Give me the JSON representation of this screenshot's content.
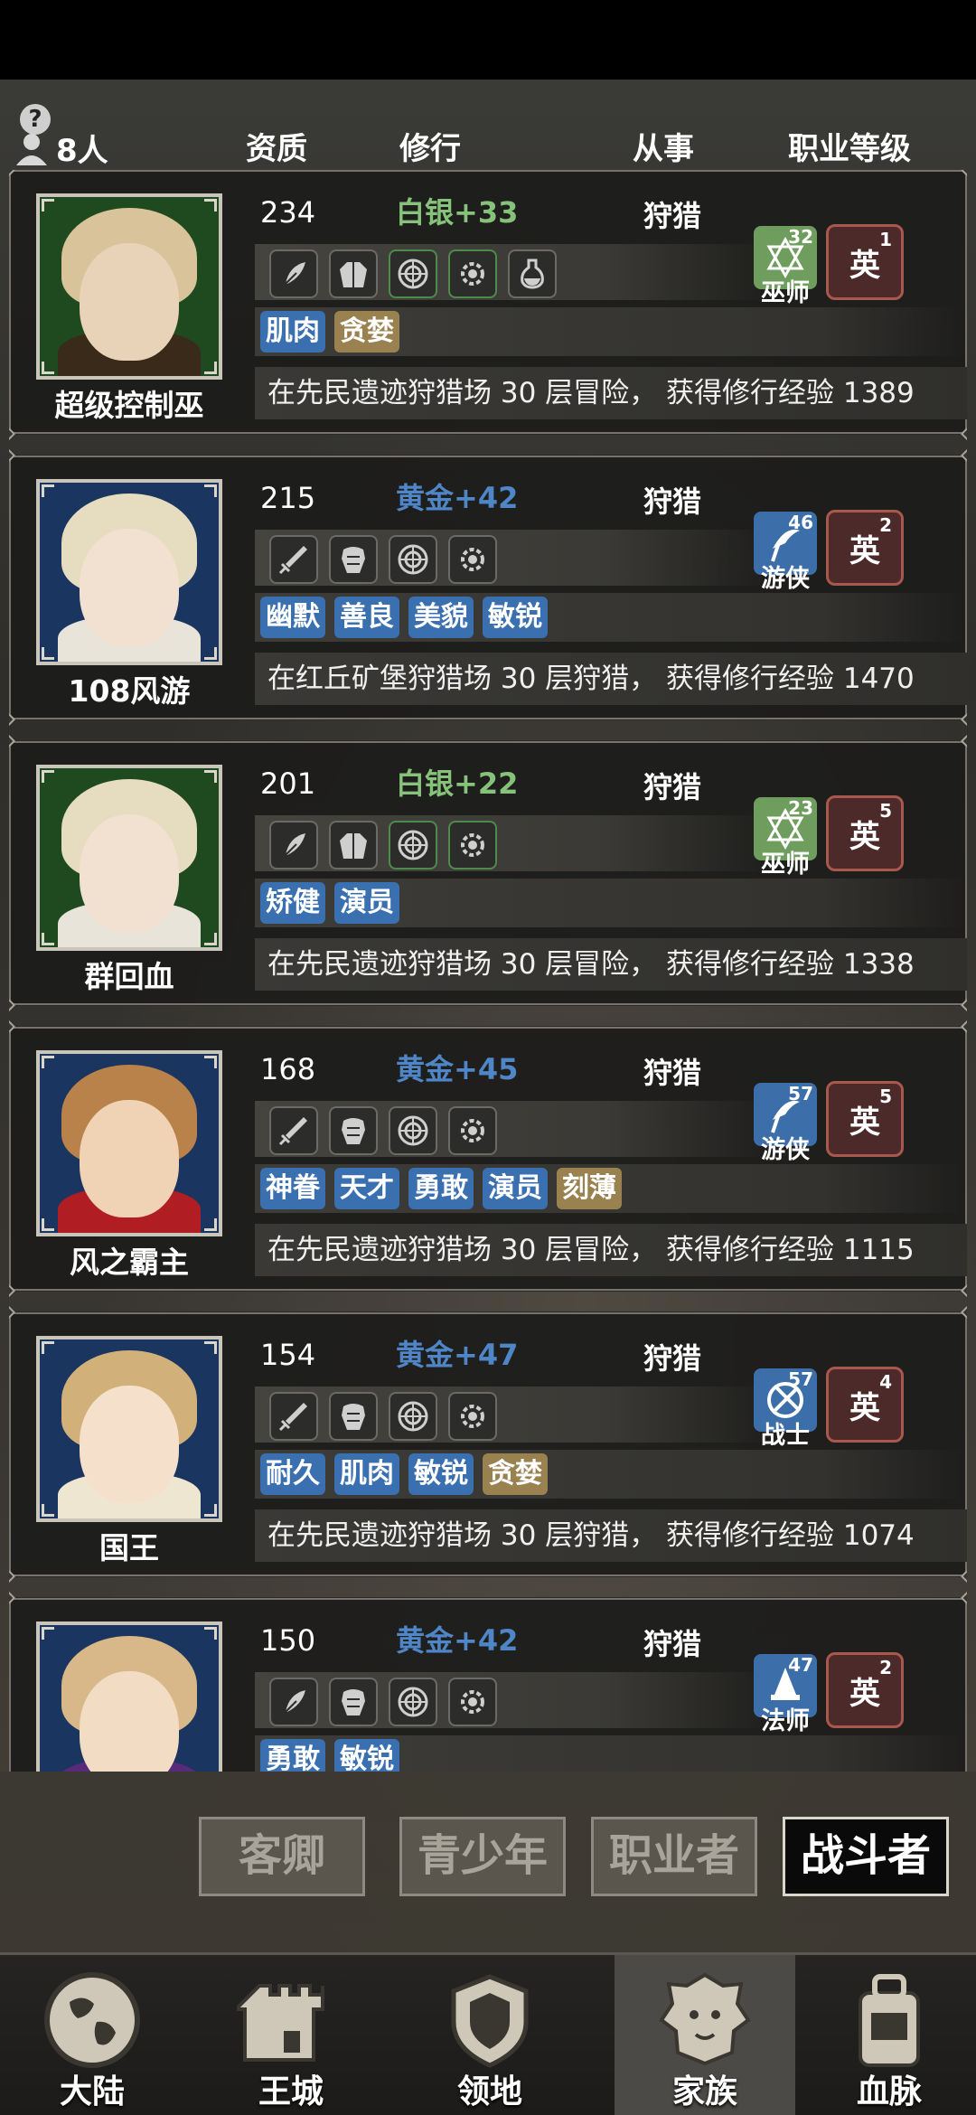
{
  "header": {
    "count": "8人",
    "columns": {
      "quality": "资质",
      "cultivation": "修行",
      "engaged": "从事",
      "job_level": "职业等级"
    }
  },
  "members": [
    {
      "name": "超级控制巫",
      "level": "234",
      "quality": "白银+33",
      "quality_color": "#86c27a",
      "job": "狩猎",
      "class_name": "巫师",
      "class_level": "32",
      "class_color": "#6f9d5e",
      "rank": "英",
      "rank_num": "1",
      "equip": [
        "feather-icon",
        "robe-icon",
        "rune-icon",
        "gear-icon",
        "potion-icon"
      ],
      "tags": [
        {
          "text": "肌肉",
          "type": "blue"
        },
        {
          "text": "贪婪",
          "type": "gold"
        }
      ],
      "activity": "在先民遗迹狩猎场 30 层冒险， 获得修行经验 1389",
      "portrait_bg": "#1f4a1f",
      "hair": "#d9c39a",
      "skin": "#e8d2b8",
      "cloth": "#3a2a1a"
    },
    {
      "name": "108风游",
      "level": "215",
      "quality": "黄金+42",
      "quality_color": "#4f86c7",
      "job": "狩猎",
      "class_name": "游侠",
      "class_level": "46",
      "class_color": "#3c6ea9",
      "rank": "英",
      "rank_num": "2",
      "equip": [
        "sword-icon",
        "armor-icon",
        "rune-icon",
        "gear-icon"
      ],
      "tags": [
        {
          "text": "幽默",
          "type": "blue"
        },
        {
          "text": "善良",
          "type": "blue"
        },
        {
          "text": "美貌",
          "type": "blue"
        },
        {
          "text": "敏锐",
          "type": "blue"
        }
      ],
      "activity": "在红丘矿堡狩猎场 30 层狩猎， 获得修行经验 1470",
      "portrait_bg": "#1a3560",
      "hair": "#e6dcc0",
      "skin": "#f2e1d0",
      "cloth": "#e8e4da"
    },
    {
      "name": "群回血",
      "level": "201",
      "quality": "白银+22",
      "quality_color": "#86c27a",
      "job": "狩猎",
      "class_name": "巫师",
      "class_level": "23",
      "class_color": "#6f9d5e",
      "rank": "英",
      "rank_num": "5",
      "equip": [
        "feather-icon",
        "robe-icon",
        "rune-icon",
        "gear-icon"
      ],
      "tags": [
        {
          "text": "矫健",
          "type": "blue"
        },
        {
          "text": "演员",
          "type": "blue"
        }
      ],
      "activity": "在先民遗迹狩猎场 30 层冒险， 获得修行经验 1338",
      "portrait_bg": "#1f4a1f",
      "hair": "#e6dcc0",
      "skin": "#f2e1d0",
      "cloth": "#e8e4da"
    },
    {
      "name": "风之霸主",
      "level": "168",
      "quality": "黄金+45",
      "quality_color": "#4f86c7",
      "job": "狩猎",
      "class_name": "游侠",
      "class_level": "57",
      "class_color": "#3c6ea9",
      "rank": "英",
      "rank_num": "5",
      "equip": [
        "sword-icon",
        "armor-icon",
        "rune-icon",
        "gear-icon"
      ],
      "tags": [
        {
          "text": "神眷",
          "type": "blue"
        },
        {
          "text": "天才",
          "type": "blue"
        },
        {
          "text": "勇敢",
          "type": "blue"
        },
        {
          "text": "演员",
          "type": "blue"
        },
        {
          "text": "刻薄",
          "type": "gold"
        }
      ],
      "activity": "在先民遗迹狩猎场 30 层冒险， 获得修行经验 1115",
      "portrait_bg": "#1a3560",
      "hair": "#b9824a",
      "skin": "#f0d2b4",
      "cloth": "#b01e24"
    },
    {
      "name": "国王",
      "level": "154",
      "quality": "黄金+47",
      "quality_color": "#4f86c7",
      "job": "狩猎",
      "class_name": "战士",
      "class_level": "57",
      "class_color": "#3c6ea9",
      "rank": "英",
      "rank_num": "4",
      "equip": [
        "sword-icon",
        "armor-icon",
        "rune-icon",
        "gear-icon"
      ],
      "tags": [
        {
          "text": "耐久",
          "type": "blue"
        },
        {
          "text": "肌肉",
          "type": "blue"
        },
        {
          "text": "敏锐",
          "type": "blue"
        },
        {
          "text": "贪婪",
          "type": "gold"
        }
      ],
      "activity": "在先民遗迹狩猎场 30 层狩猎， 获得修行经验 1074",
      "portrait_bg": "#1a3560",
      "hair": "#d2b07a",
      "skin": "#f5e0cc",
      "cloth": "#efe6d2"
    },
    {
      "name": "",
      "level": "150",
      "quality": "黄金+42",
      "quality_color": "#4f86c7",
      "job": "狩猎",
      "class_name": "法师",
      "class_level": "47",
      "class_color": "#3c6ea9",
      "rank": "英",
      "rank_num": "2",
      "equip": [
        "feather-icon",
        "armor-icon",
        "rune-icon",
        "gear-icon"
      ],
      "tags": [
        {
          "text": "勇敢",
          "type": "blue"
        },
        {
          "text": "敏锐",
          "type": "blue"
        }
      ],
      "activity": "",
      "portrait_bg": "#1a3560",
      "hair": "#d8b888",
      "skin": "#f2dcc4",
      "cloth": "#5a2a7a"
    }
  ],
  "filter_tabs": [
    {
      "label": "客卿",
      "active": false
    },
    {
      "label": "青少年",
      "active": false
    },
    {
      "label": "职业者",
      "active": false
    },
    {
      "label": "战斗者",
      "active": true
    }
  ],
  "nav": [
    {
      "label": "大陆",
      "icon": "globe-icon",
      "active": false
    },
    {
      "label": "王城",
      "icon": "castle-tower-icon",
      "active": false
    },
    {
      "label": "领地",
      "icon": "shield-crest-icon",
      "active": false
    },
    {
      "label": "家族",
      "icon": "lion-head-icon",
      "active": true
    },
    {
      "label": "血脉",
      "icon": "backpack-icon",
      "active": false
    }
  ]
}
